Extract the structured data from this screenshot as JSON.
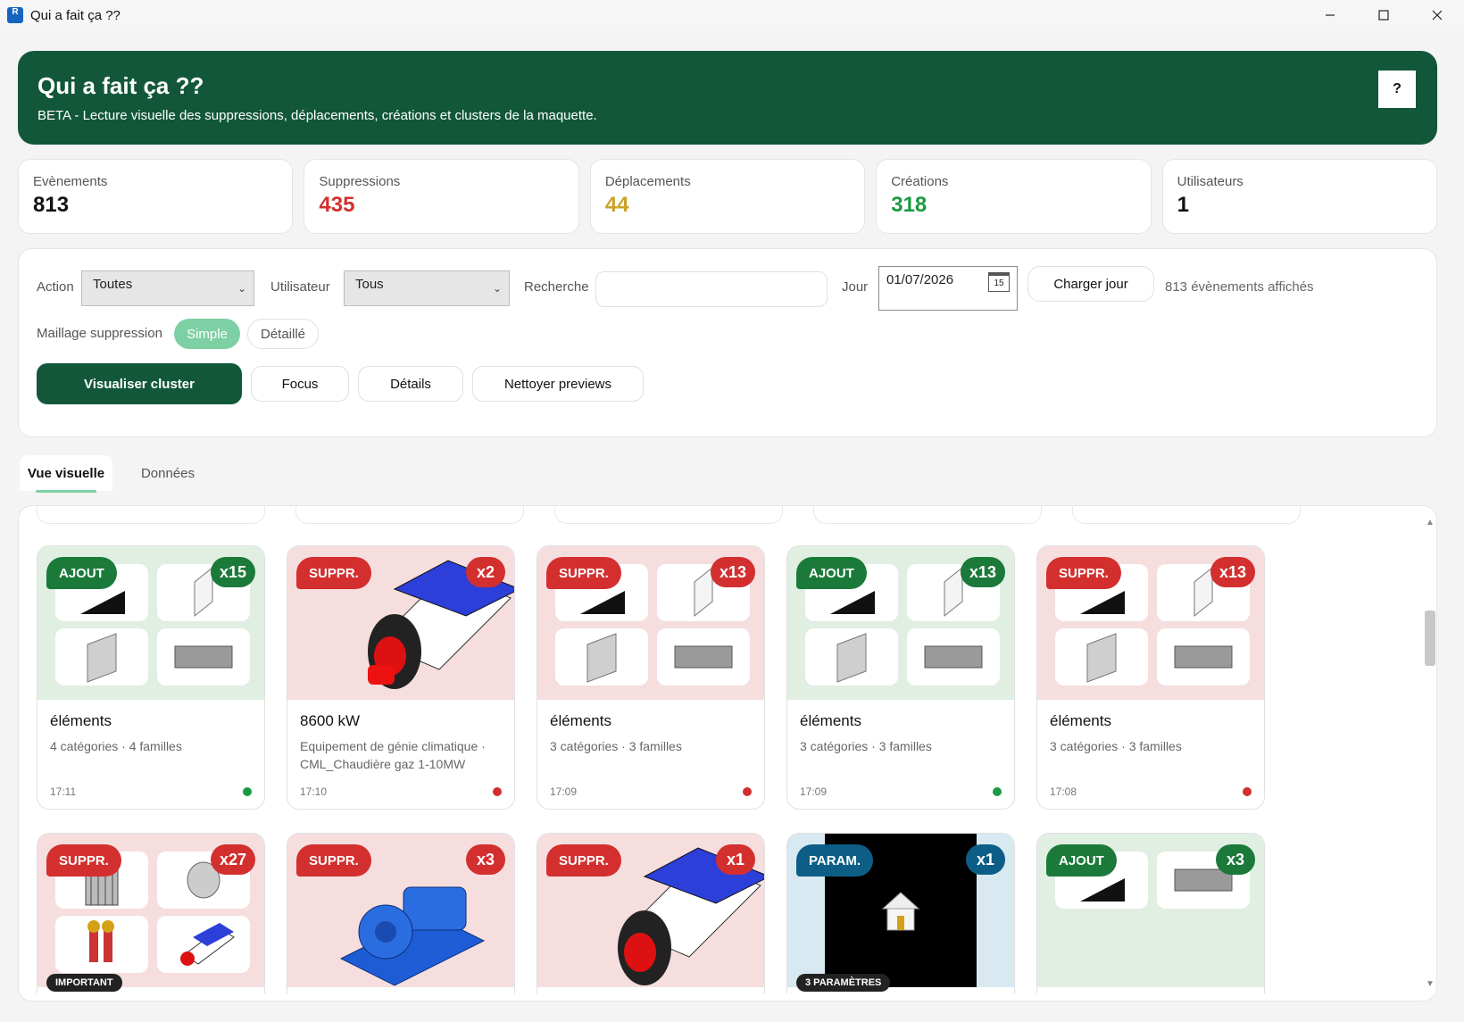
{
  "window": {
    "title": "Qui a fait ça ??",
    "icon_letter": "R",
    "minimize_icon": "minimize-icon",
    "maximize_icon": "maximize-icon",
    "close_icon": "close-icon"
  },
  "header": {
    "title": "Qui a fait ça ??",
    "subtitle": "BETA - Lecture visuelle des suppressions, déplacements, créations et clusters de la maquette.",
    "help_label": "?"
  },
  "stats": [
    {
      "label": "Evènements",
      "value": "813",
      "color": "#111111"
    },
    {
      "label": "Suppressions",
      "value": "435",
      "color": "#d32f2f"
    },
    {
      "label": "Déplacements",
      "value": "44",
      "color": "#c9a227"
    },
    {
      "label": "Créations",
      "value": "318",
      "color": "#1b9a44"
    },
    {
      "label": "Utilisateurs",
      "value": "1",
      "color": "#111111"
    }
  ],
  "filters": {
    "action_label": "Action",
    "action_value": "Toutes",
    "user_label": "Utilisateur",
    "user_value": "Tous",
    "search_label": "Recherche",
    "search_value": "",
    "day_label": "Jour",
    "day_value": "01/07/2026",
    "calendar_day": "15",
    "load_day_label": "Charger jour",
    "displayed_count": "813 évènements affichés",
    "mesh_label": "Maillage suppression",
    "mesh_simple": "Simple",
    "mesh_detailed": "Détaillé"
  },
  "actions": {
    "visualize_cluster": "Visualiser cluster",
    "focus": "Focus",
    "details": "Détails",
    "clean_previews": "Nettoyer previews"
  },
  "tabs": [
    {
      "label": "Vue visuelle",
      "active": true
    },
    {
      "label": "Données",
      "active": false
    }
  ],
  "cards_row1": [
    {
      "badge": "AJOUT",
      "count": "x15",
      "title": "éléments",
      "subtitle": "4 catégories · 4 familles",
      "time": "17:11",
      "kind": "green"
    },
    {
      "badge": "SUPPR.",
      "count": "x2",
      "title": "8600 kW",
      "subtitle": "Equipement de génie climatique · CML_Chaudière gaz 1-10MW",
      "time": "17:10",
      "kind": "red"
    },
    {
      "badge": "SUPPR.",
      "count": "x13",
      "title": "éléments",
      "subtitle": "3 catégories · 3 familles",
      "time": "17:09",
      "kind": "red"
    },
    {
      "badge": "AJOUT",
      "count": "x13",
      "title": "éléments",
      "subtitle": "3 catégories · 3 familles",
      "time": "17:09",
      "kind": "green"
    },
    {
      "badge": "SUPPR.",
      "count": "x13",
      "title": "éléments",
      "subtitle": "3 catégories · 3 familles",
      "time": "17:08",
      "kind": "red"
    }
  ],
  "cards_row2": [
    {
      "badge": "SUPPR.",
      "count": "x27",
      "tag": "IMPORTANT",
      "kind": "red"
    },
    {
      "badge": "SUPPR.",
      "count": "x3",
      "tag": "",
      "kind": "red"
    },
    {
      "badge": "SUPPR.",
      "count": "x1",
      "tag": "",
      "kind": "red"
    },
    {
      "badge": "PARAM.",
      "count": "x1",
      "tag": "3 PARAMÈTRES",
      "kind": "blue"
    },
    {
      "badge": "AJOUT",
      "count": "x3",
      "tag": "",
      "kind": "green"
    }
  ],
  "colors": {
    "brand": "#12573a",
    "accent": "#7dd0a3",
    "delete": "#d32f2f",
    "add": "#1b7a3a",
    "param": "#0d5e87"
  }
}
